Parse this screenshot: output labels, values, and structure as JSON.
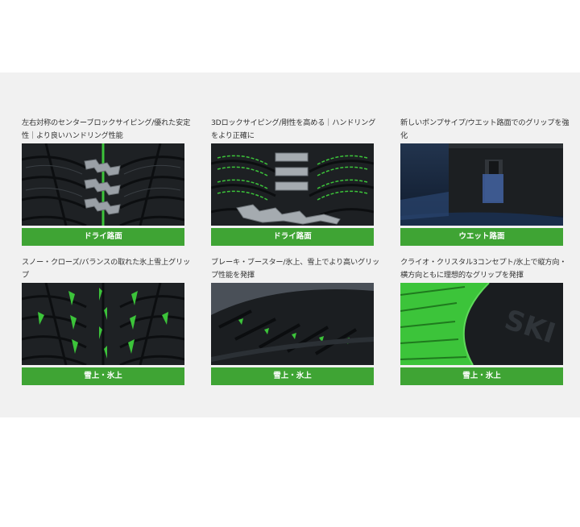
{
  "features": [
    {
      "caption": "左右対称のセンターブロックサイピング/優れた安定性｜より良いハンドリング性能",
      "label": "ドライ路面",
      "image": "tread-center-block-sipes"
    },
    {
      "caption": "3Dロックサイピング/剛性を高める｜ハンドリングをより正確に",
      "label": "ドライ路面",
      "image": "tread-3d-lock-sipes"
    },
    {
      "caption": "新しいポンプサイプ/ウエット路面でのグリップを強化",
      "label": "ウエット路面",
      "image": "pump-sipe-wet-road"
    },
    {
      "caption": "スノー・クローズ/バランスの取れた氷上雪上グリップ",
      "label": "雪上・氷上",
      "image": "tread-snow-claws"
    },
    {
      "caption": "ブレーキ・ブースター/氷上、雪上でより高いグリップ性能を発揮",
      "label": "雪上・氷上",
      "image": "tire-brake-booster"
    },
    {
      "caption": "クライオ・クリスタル3コンセプト/氷上で縦方向・横方向ともに理想的なグリップを発揮",
      "label": "雪上・氷上",
      "image": "tire-cryo-crystal"
    }
  ],
  "colors": {
    "band": "#f1f1f1",
    "label_green": "#3fa434",
    "highlight_green": "#3cc43a",
    "tread_dark": "#1c1f22"
  }
}
